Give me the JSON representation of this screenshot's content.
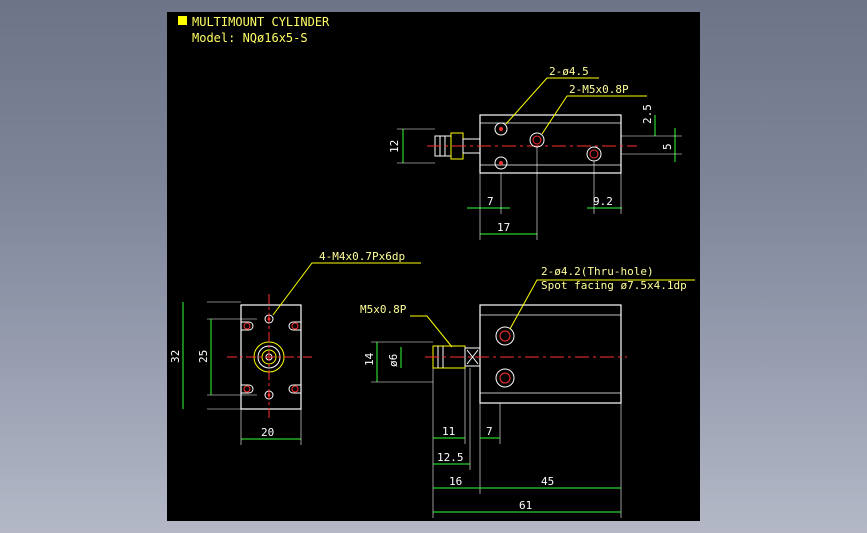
{
  "title_block": {
    "line1": "MULTIMOUNT CYLINDER",
    "line2": "Model: NQø16x5-S"
  },
  "top_view": {
    "callout_holes": "2-ø4.5",
    "callout_ports": "2-M5x0.8P",
    "dims": {
      "height": "12",
      "offset_2_5": "2.5",
      "offset_5": "5",
      "d7": "7",
      "d17": "17",
      "d9_2": "9.2"
    }
  },
  "front_view": {
    "callout_taps": "4-M4x0.7Px6dp",
    "dims": {
      "h32": "32",
      "h25": "25",
      "w20": "20"
    }
  },
  "side_view": {
    "callout_thru_1": "2-ø4.2(Thru-hole)",
    "callout_thru_2": "Spot facing ø7.5x4.1dp",
    "callout_port": "M5x0.8P",
    "dims": {
      "h14": "14",
      "d6": "ø6",
      "d11": "11",
      "d7": "7",
      "d12_5": "12.5",
      "d16": "16",
      "d45": "45",
      "d61": "61"
    }
  },
  "colors": {
    "line_white": "#ffffff",
    "line_yellow": "#ffff00",
    "line_red": "#ff3030",
    "line_green": "#33ff33",
    "line_cyan": "#33ffff"
  }
}
